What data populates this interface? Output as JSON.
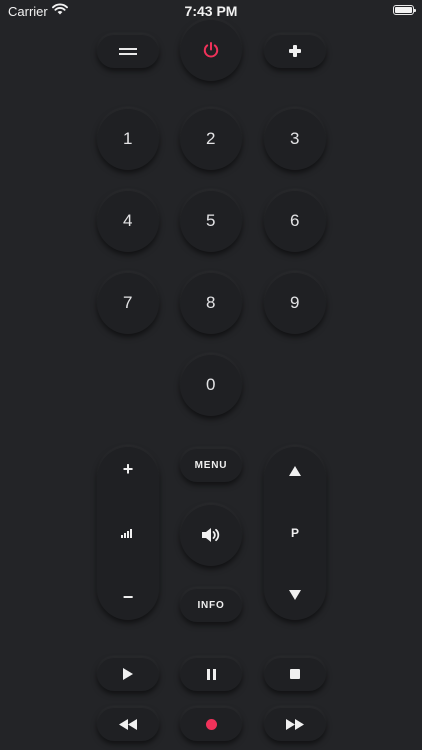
{
  "status_bar": {
    "carrier": "Carrier",
    "time": "7:43 PM"
  },
  "top_row": {
    "power_color": "#f0325a"
  },
  "keypad": {
    "digits": [
      "1",
      "2",
      "3",
      "4",
      "5",
      "6",
      "7",
      "8",
      "9",
      "0"
    ]
  },
  "controls": {
    "menu_label": "MENU",
    "info_label": "INFO",
    "volume_up": "+",
    "volume_down": "−",
    "channel_label": "P"
  },
  "playback": {
    "record_color": "#f0325a"
  },
  "icons": [
    "menu-icon",
    "power-icon",
    "plus-icon",
    "signal-bars-icon",
    "speaker-icon",
    "triangle-up-icon",
    "triangle-down-icon",
    "play-icon",
    "pause-icon",
    "stop-icon",
    "rewind-icon",
    "record-icon",
    "fast-forward-icon"
  ]
}
